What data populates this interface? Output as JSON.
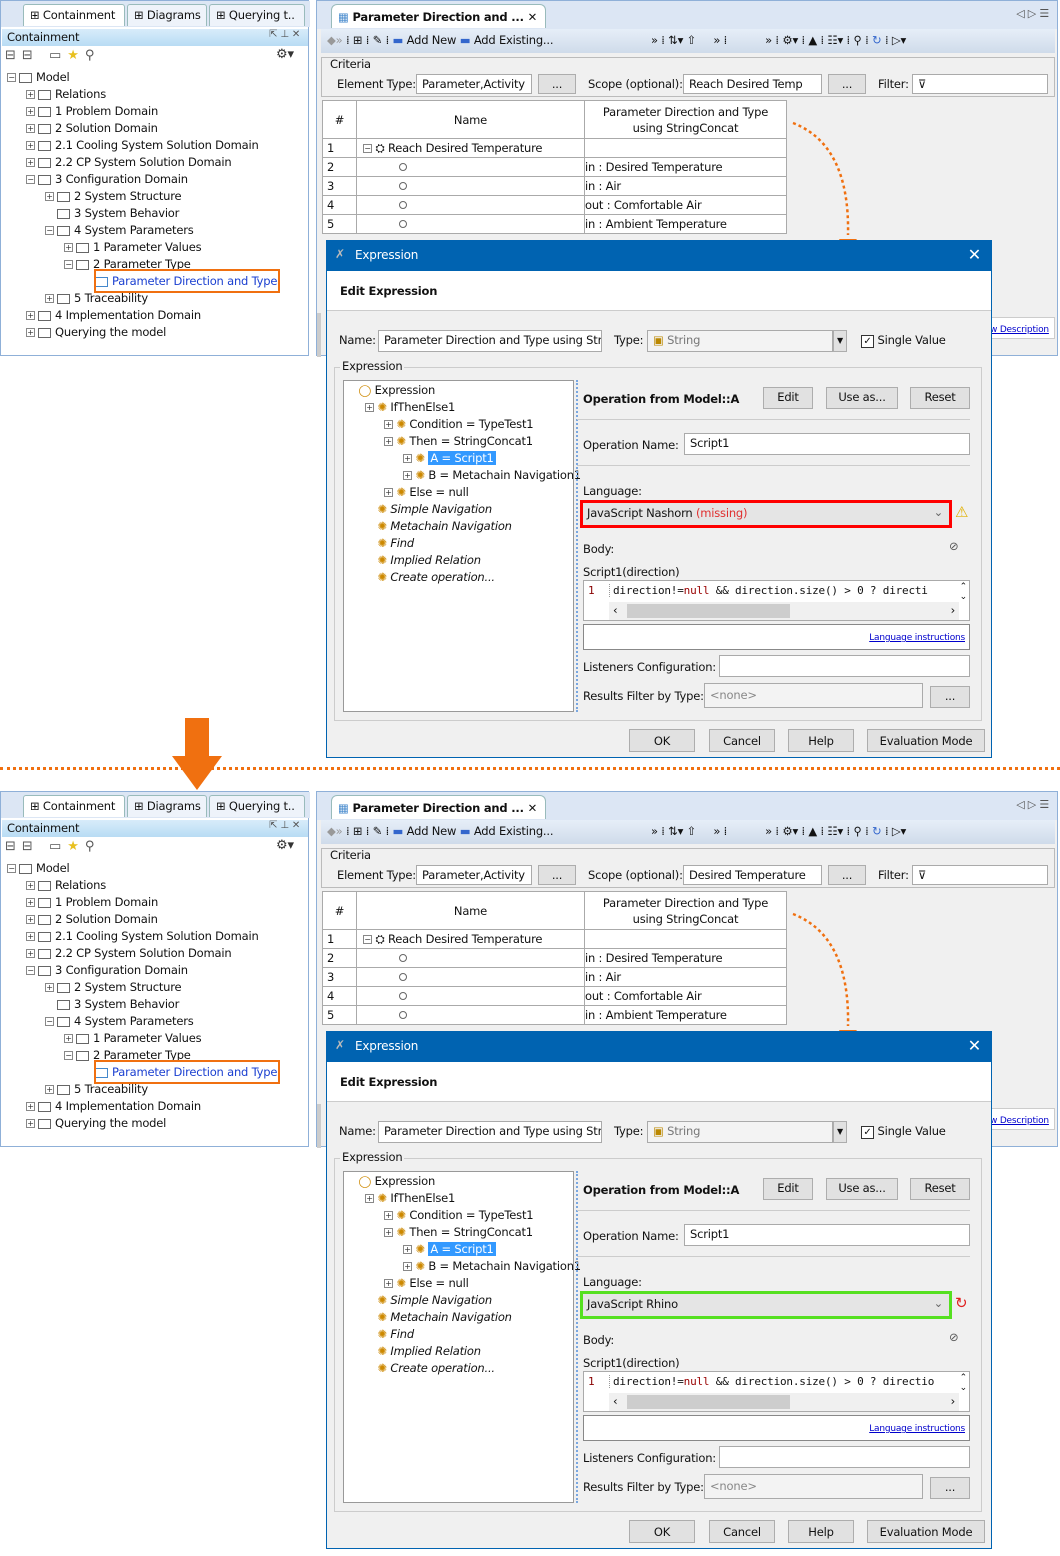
{
  "left_panel": {
    "tabs": [
      "Containment",
      "Diagrams",
      "Querying t.."
    ],
    "header": "Containment",
    "tree": [
      {
        "label": "Model",
        "level": 0,
        "expanded": true
      },
      {
        "label": "Relations",
        "level": 1,
        "expanded": false
      },
      {
        "label": "1 Problem Domain",
        "level": 1,
        "expanded": false
      },
      {
        "label": "2 Solution Domain",
        "level": 1,
        "expanded": false
      },
      {
        "label": "2.1 Cooling System Solution Domain",
        "level": 1,
        "expanded": false
      },
      {
        "label": "2.2 CP System Solution Domain",
        "level": 1,
        "expanded": false
      },
      {
        "label": "3 Configuration Domain",
        "level": 1,
        "expanded": true
      },
      {
        "label": "2 System Structure",
        "level": 2,
        "expanded": false
      },
      {
        "label": "3 System Behavior",
        "level": 2,
        "expanded": null
      },
      {
        "label": "4 System Parameters",
        "level": 2,
        "expanded": true
      },
      {
        "label": "1 Parameter Values",
        "level": 3,
        "expanded": false
      },
      {
        "label": "2 Parameter Type",
        "level": 3,
        "expanded": true
      },
      {
        "label": "Parameter Direction and Type",
        "level": 4,
        "expanded": null,
        "highlighted": true
      },
      {
        "label": "5 Traceability",
        "level": 2,
        "expanded": false
      },
      {
        "label": "4 Implementation Domain",
        "level": 1,
        "expanded": false
      },
      {
        "label": "Querying the model",
        "level": 1,
        "expanded": false
      }
    ]
  },
  "editor": {
    "tab_title": "Parameter Direction and ...",
    "toolbar": {
      "add_new": "Add New",
      "add_existing": "Add Existing..."
    },
    "criteria": {
      "label": "Criteria",
      "element_type_label": "Element Type:",
      "element_type": "Parameter,Activity",
      "browse": "...",
      "scope_label": "Scope (optional):",
      "filter_label": "Filter:"
    },
    "table": {
      "headers": [
        "#",
        "Name",
        "Parameter Direction and Type using StringConcat"
      ],
      "rows": [
        {
          "num": "1",
          "name": "Reach Desired Temperature",
          "value": ""
        },
        {
          "num": "2",
          "name": "",
          "value": "in : Desired Temperature"
        },
        {
          "num": "3",
          "name": "",
          "value": "in : Air"
        },
        {
          "num": "4",
          "name": "",
          "value": "out : Comfortable Air"
        },
        {
          "num": "5",
          "name": "",
          "value": "in : Ambient Temperature"
        }
      ]
    },
    "description_link": "w Description"
  },
  "dialog": {
    "title": "Expression",
    "heading": "Edit Expression",
    "name_label": "Name:",
    "name_value": "Parameter Direction and Type using StringConcat",
    "type_label": "Type:",
    "type_value": "String",
    "single_value": "Single Value",
    "expression_group": "Expression",
    "tree": [
      {
        "label": "Expression",
        "level": 0,
        "italic": false
      },
      {
        "label": "IfThenElse1",
        "level": 1,
        "italic": false
      },
      {
        "label": "Condition = TypeTest1",
        "level": 2,
        "italic": false
      },
      {
        "label": "Then = StringConcat1",
        "level": 2,
        "italic": false
      },
      {
        "label": "A = Script1",
        "level": 3,
        "italic": false,
        "selected": true
      },
      {
        "label": "B = Metachain Navigation1",
        "level": 3,
        "italic": false
      },
      {
        "label": "Else = null",
        "level": 2,
        "italic": false
      },
      {
        "label": "Simple Navigation",
        "level": 1,
        "italic": true
      },
      {
        "label": "Metachain Navigation",
        "level": 1,
        "italic": true
      },
      {
        "label": "Find",
        "level": 1,
        "italic": true
      },
      {
        "label": "Implied Relation",
        "level": 1,
        "italic": true
      },
      {
        "label": "Create operation...",
        "level": 1,
        "italic": true
      }
    ],
    "operation_title": "Operation from Model::A",
    "edit": "Edit",
    "use_as": "Use as...",
    "reset": "Reset",
    "operation_name_label": "Operation Name:",
    "operation_name": "Script1",
    "language_label": "Language:",
    "body_label": "Body:",
    "signature": "Script1(direction)",
    "line_number": "1",
    "language_instructions": "Language instructions",
    "listeners_label": "Listeners Configuration:",
    "results_filter_label": "Results Filter by Type:",
    "results_filter_value": "<none>",
    "buttons": {
      "ok": "OK",
      "cancel": "Cancel",
      "help": "Help",
      "evaluation_mode": "Evaluation Mode"
    }
  },
  "states": [
    {
      "scope": "Reach Desired Temp",
      "language": "JavaScript Nashorn",
      "language_suffix": "(missing)",
      "language_border": "#ff0000",
      "status_icon": "warning-icon",
      "code": [
        "direction!=",
        "null",
        " && direction.size() > 0 ? directi"
      ]
    },
    {
      "scope": "Desired Temperature",
      "language": "JavaScript Rhino",
      "language_suffix": "",
      "language_border": "#55e020",
      "status_icon": "running-icon",
      "code": [
        "direction!=",
        "null",
        " && direction.size() > 0 ? directio"
      ]
    }
  ],
  "colors": {
    "accent": "#0063b1",
    "annotation": "#f07010",
    "selection": "#3399ff"
  }
}
